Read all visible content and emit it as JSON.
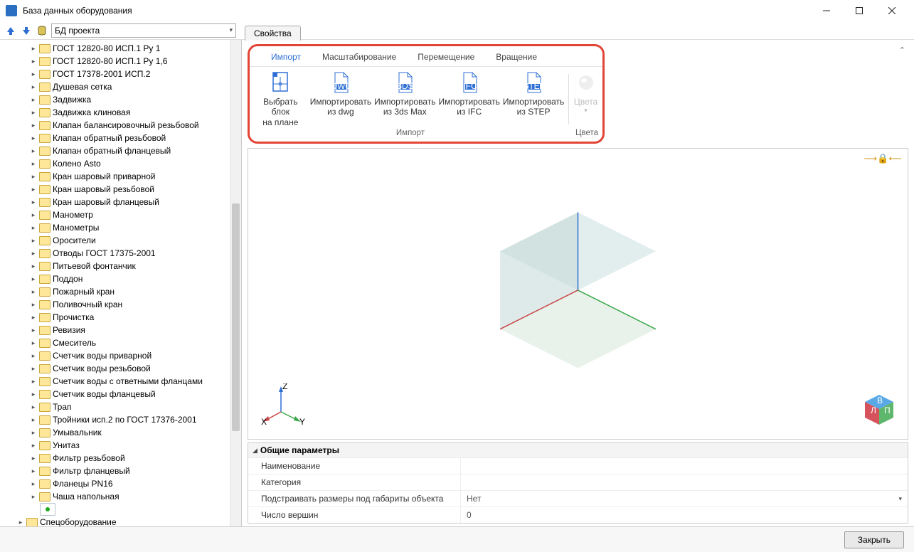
{
  "window": {
    "title": "База данных оборудования"
  },
  "toolbar": {
    "db_selected": "БД проекта"
  },
  "side_tab": {
    "label": "Свойства"
  },
  "tree": {
    "items": [
      "ГОСТ 12820-80 ИСП.1 Ру 1",
      "ГОСТ 12820-80 ИСП.1 Ру 1,6",
      "ГОСТ 17378-2001 ИСП.2",
      "Душевая сетка",
      "Задвижка",
      "Задвижка клиновая",
      "Клапан балансировочный резьбовой",
      "Клапан обратный резьбовой",
      "Клапан обратный фланцевый",
      "Колено Asto",
      "Кран шаровый приварной",
      "Кран шаровый резьбовой",
      "Кран шаровый фланцевый",
      "Манометр",
      "Манометры",
      "Оросители",
      "Отводы ГОСТ 17375-2001",
      "Питьевой фонтанчик",
      "Поддон",
      "Пожарный кран",
      "Поливочный кран",
      "Прочистка",
      "Ревизия",
      "Смеситель",
      "Счетчик воды приварной",
      "Счетчик воды резьбовой",
      "Счетчик воды с ответными фланцами",
      "Счетчик воды фланцевый",
      "Трап",
      "Тройники исп.2 по ГОСТ 17376-2001",
      "Умывальник",
      "Унитаз",
      "Фильтр резьбовой",
      "Фильтр фланцевый",
      "Фланецы PN16",
      "Чаша напольная"
    ],
    "root": "Спецоборудование"
  },
  "ribbon": {
    "tabs": [
      "Импорт",
      "Масштабирование",
      "Перемещение",
      "Вращение"
    ],
    "active_tab": 0,
    "buttons": {
      "select_block": {
        "line1": "Выбрать блок",
        "line2": "на плане"
      },
      "import_dwg": {
        "line1": "Импортировать",
        "line2": "из dwg",
        "badge": "DWG"
      },
      "import_3ds": {
        "line1": "Импортировать",
        "line2": "из 3ds Max",
        "badge": "3DS"
      },
      "import_ifc": {
        "line1": "Импортировать",
        "line2": "из IFC",
        "badge": "IFC"
      },
      "import_step": {
        "line1": "Импортировать",
        "line2": "из STEP",
        "badge": "STEP"
      },
      "colors_label": "Цвета",
      "colors_disabled": "Цвета"
    },
    "group_label": "Импорт"
  },
  "axis_labels": {
    "x": "X",
    "y": "Y",
    "z": "Z"
  },
  "cube_labels": {
    "left": "Л",
    "front": "П",
    "top": "В"
  },
  "properties": {
    "header": "Общие параметры",
    "rows": [
      {
        "label": "Наименование",
        "value": ""
      },
      {
        "label": "Категория",
        "value": ""
      },
      {
        "label": "Подстраивать размеры под габариты объекта",
        "value": "Нет",
        "dropdown": true
      },
      {
        "label": "Число вершин",
        "value": "0"
      }
    ]
  },
  "footer": {
    "close": "Закрыть"
  }
}
